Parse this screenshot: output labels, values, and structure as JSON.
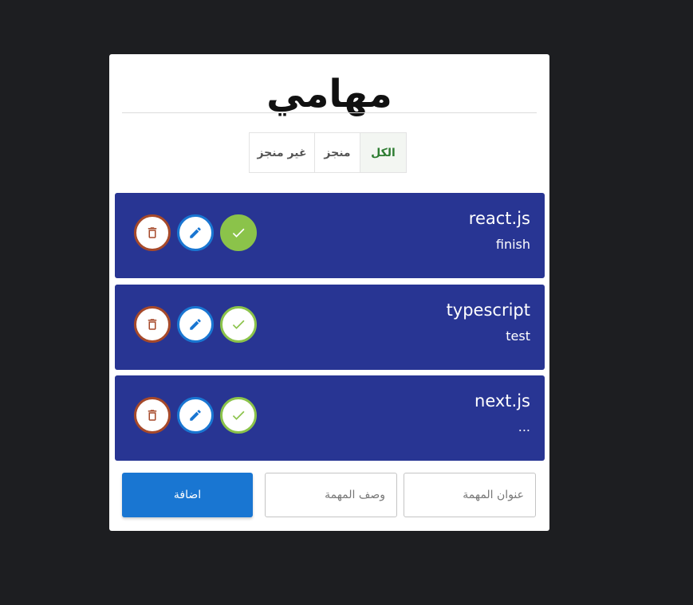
{
  "page": {
    "title": "مهامي"
  },
  "filters": [
    {
      "label": "الكل",
      "active": true
    },
    {
      "label": "منجز",
      "active": false
    },
    {
      "label": "غير منجز",
      "active": false
    }
  ],
  "todos": [
    {
      "title": "react.js",
      "description": "finish",
      "completed": true
    },
    {
      "title": "typescript",
      "description": "test",
      "completed": false
    },
    {
      "title": "next.js",
      "description": "...",
      "completed": false
    }
  ],
  "form": {
    "title_placeholder": "عنوان المهمة",
    "desc_placeholder": "وصف المهمة",
    "add_label": "اضافة"
  },
  "colors": {
    "background": "#1d1e21",
    "card": "#ffffff",
    "todo_bg": "#283593",
    "delete": "#a6492a",
    "edit": "#1976d2",
    "done": "#8bc34a",
    "add_button": "#1976d2",
    "active_filter_text": "#2e7d32"
  },
  "icons": {
    "delete": "trash-icon",
    "edit": "pencil-icon",
    "done": "check-icon"
  }
}
